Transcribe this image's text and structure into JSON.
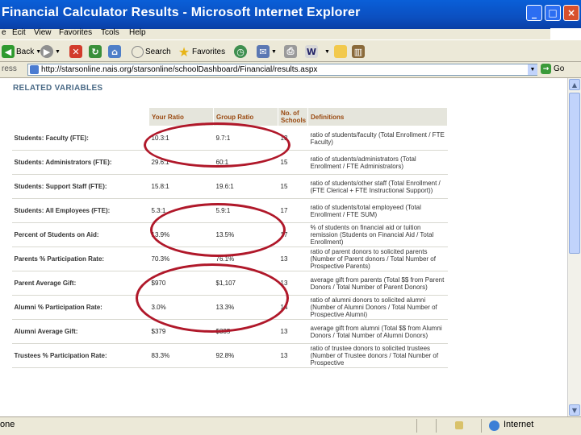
{
  "window": {
    "title": "Financial Calculator Results - Microsoft Internet Explorer"
  },
  "menu": {
    "file": "e",
    "edit": "Ecit",
    "view": "View",
    "favorites": "Favorites",
    "tools": "Tcols",
    "help": "Help"
  },
  "toolbar": {
    "back": "Back",
    "search": "Search",
    "favorites": "Favorites"
  },
  "address": {
    "label": "ress",
    "url": "http://starsonline.nais.org/starsonline/schoolDashboard/Financial/results.aspx",
    "go": "Go"
  },
  "page": {
    "section_title": "RELATED VARIABLES",
    "columns": {
      "ratio": "Your Ratio",
      "group": "Group Ratio",
      "schools": "No. of Schools",
      "defs": "Definitions"
    },
    "rows": [
      {
        "label": "Students: Faculty (FTE):",
        "ratio": "10.3:1",
        "group": "9.7:1",
        "schools": "13",
        "def": "ratio of students/faculty (Total Enrollment / FTE Faculty)"
      },
      {
        "label": "Students: Administrators (FTE):",
        "ratio": "29.6:1",
        "group": "60:1",
        "schools": "15",
        "def": "ratio of students/administrators (Total Enrollment / FTE Administrators)"
      },
      {
        "label": "Students: Support Staff (FTE):",
        "ratio": "15.8:1",
        "group": "19.6:1",
        "schools": "15",
        "def": "ratio of students/other staff (Total Enrollment / (FTE Clerical + FTE Instructional Support))"
      },
      {
        "label": "Students: All Employees (FTE):",
        "ratio": "5.3:1",
        "group": "5.9:1",
        "schools": "17",
        "def": "ratio of students/total employeed (Total Enrollment / FTE SUM)"
      },
      {
        "label": "Percent of Students on Aid:",
        "ratio": "13.9%",
        "group": "13.5%",
        "schools": "17",
        "def": "% of students on financial aid or tuition remission (Students on Financial Aid / Total Enrollment)"
      },
      {
        "label": "Parents % Participation Rate:",
        "ratio": "70.3%",
        "group": "76.1%",
        "schools": "13",
        "def": "ratio of parent donors to solicited parents (Number of Parent donors / Total Number of Prospective Parents)"
      },
      {
        "label": "Parent Average Gift:",
        "ratio": "$970",
        "group": "$1,107",
        "schools": "13",
        "def": "average gift from parents (Total $$ from Parent Donors / Total Number of Parent Donors)"
      },
      {
        "label": "Alumni % Participation Rate:",
        "ratio": "3.0%",
        "group": "13.3%",
        "schools": "14",
        "def": "ratio of alumni donors to solicited alumni (Number of Alumni Donors / Total Number of Prospective Alumni)"
      },
      {
        "label": "Alumni Average Gift:",
        "ratio": "$379",
        "group": "$335",
        "schools": "13",
        "def": "average gift from alumni (Total $$ from Alumni Donors / Total Number of Alumni Donors)"
      },
      {
        "label": "Trustees % Participation Rate:",
        "ratio": "83.3%",
        "group": "92.8%",
        "schools": "13",
        "def": "ratio of trustee donors to solicited trustees (Number of Trustee donors / Total Number of Prospective"
      }
    ]
  },
  "status": {
    "left": "one",
    "zone": "Internet"
  },
  "icons": [
    "ie-logo-icon",
    "back-icon",
    "forward-icon",
    "stop-icon",
    "refresh-icon",
    "home-icon",
    "search-icon",
    "favorites-star-icon",
    "history-icon",
    "mail-icon",
    "print-icon",
    "edit-icon",
    "folder-icon",
    "research-icon",
    "go-icon",
    "globe-icon",
    "lock-icon"
  ]
}
